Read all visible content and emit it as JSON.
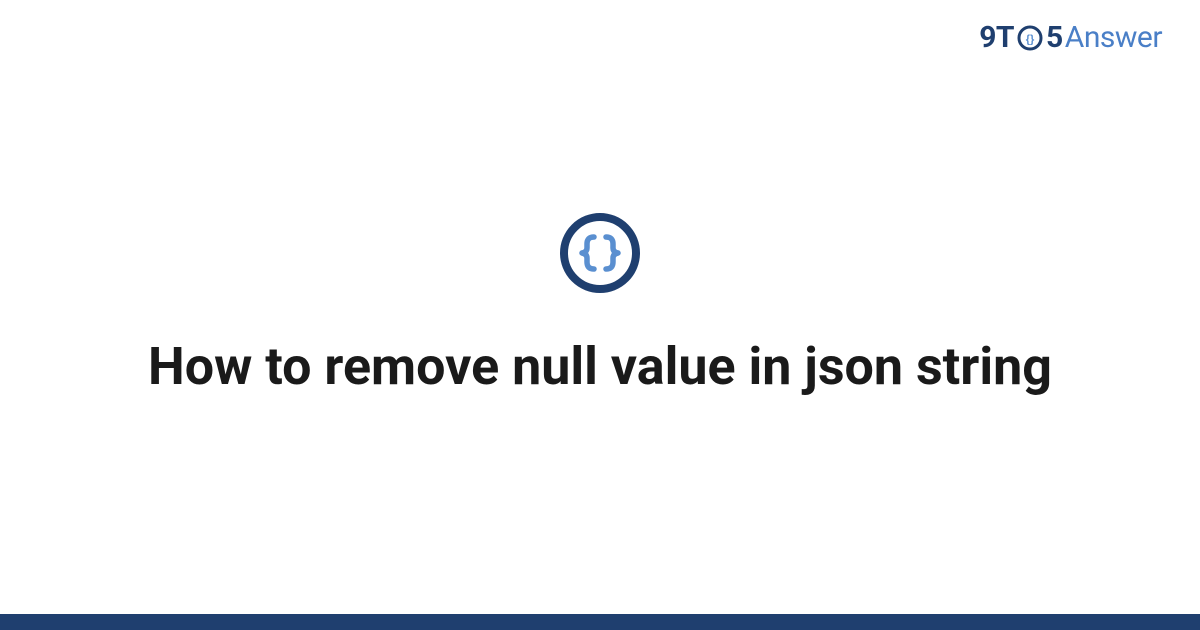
{
  "brand": {
    "part1": "9T",
    "part2": "5",
    "part3": "Answer"
  },
  "topic_icon": "json-braces-icon",
  "title": "How to remove null value in json string",
  "colors": {
    "brand_dark": "#1f3f6f",
    "brand_light": "#4a7fc7",
    "icon_ring": "#1f3f6f",
    "icon_brace": "#5a8fd0",
    "text": "#1a1a1a"
  }
}
